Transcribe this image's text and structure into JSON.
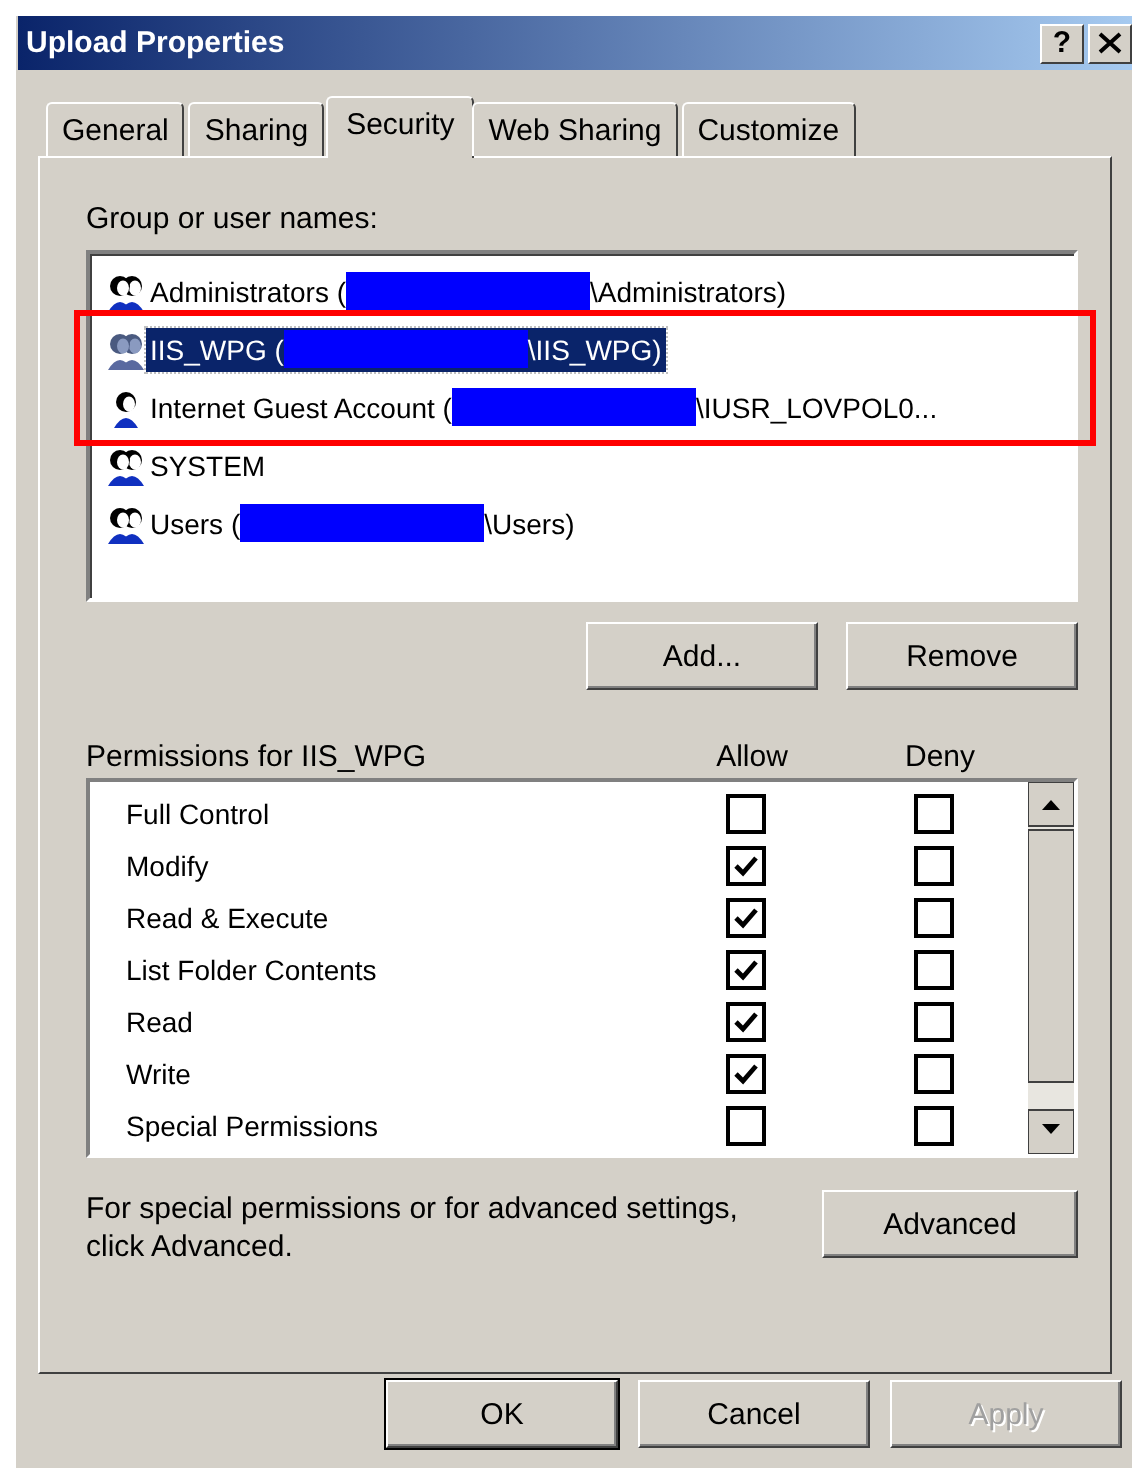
{
  "window": {
    "title": "Upload Properties",
    "help_button": "?"
  },
  "tabs": [
    {
      "label": "General",
      "selected": false
    },
    {
      "label": "Sharing",
      "selected": false
    },
    {
      "label": "Security",
      "selected": true
    },
    {
      "label": "Web Sharing",
      "selected": false
    },
    {
      "label": "Customize",
      "selected": false
    }
  ],
  "users": {
    "label": "Group or user names:",
    "items": [
      {
        "kind": "group",
        "name": "Administrators (",
        "redacted": true,
        "account": "\\Administrators)",
        "selected": false,
        "highlighted": false
      },
      {
        "kind": "group",
        "name": "IIS_WPG (",
        "redacted": true,
        "account": "\\IIS_WPG)",
        "selected": true,
        "highlighted": true
      },
      {
        "kind": "user",
        "name": "Internet Guest Account (",
        "redacted": true,
        "account": "\\IUSR_LOVPOL0...",
        "selected": false,
        "highlighted": true
      },
      {
        "kind": "group",
        "name": "SYSTEM",
        "redacted": false,
        "selected": false,
        "highlighted": false
      },
      {
        "kind": "group",
        "name": "Users (",
        "redacted": true,
        "account": "\\Users)",
        "selected": false,
        "highlighted": false
      }
    ],
    "buttons": [
      "Add...",
      "Remove"
    ]
  },
  "permissions": {
    "label": "Permissions for IIS_WPG",
    "columns": [
      "Allow",
      "Deny"
    ],
    "rows": [
      {
        "name": "Full Control",
        "allow": false,
        "deny": false
      },
      {
        "name": "Modify",
        "allow": true,
        "deny": false
      },
      {
        "name": "Read & Execute",
        "allow": true,
        "deny": false
      },
      {
        "name": "List Folder Contents",
        "allow": true,
        "deny": false
      },
      {
        "name": "Read",
        "allow": true,
        "deny": false
      },
      {
        "name": "Write",
        "allow": true,
        "deny": false
      },
      {
        "name": "Special Permissions",
        "allow": false,
        "deny": false
      }
    ]
  },
  "advanced": {
    "note": "For special permissions or for advanced settings, click Advanced.",
    "button": "Advanced"
  },
  "buttons": [
    {
      "label": "OK",
      "default": true,
      "disabled": false
    },
    {
      "label": "Cancel",
      "default": false,
      "disabled": false
    },
    {
      "label": "Apply",
      "default": false,
      "disabled": true
    }
  ]
}
